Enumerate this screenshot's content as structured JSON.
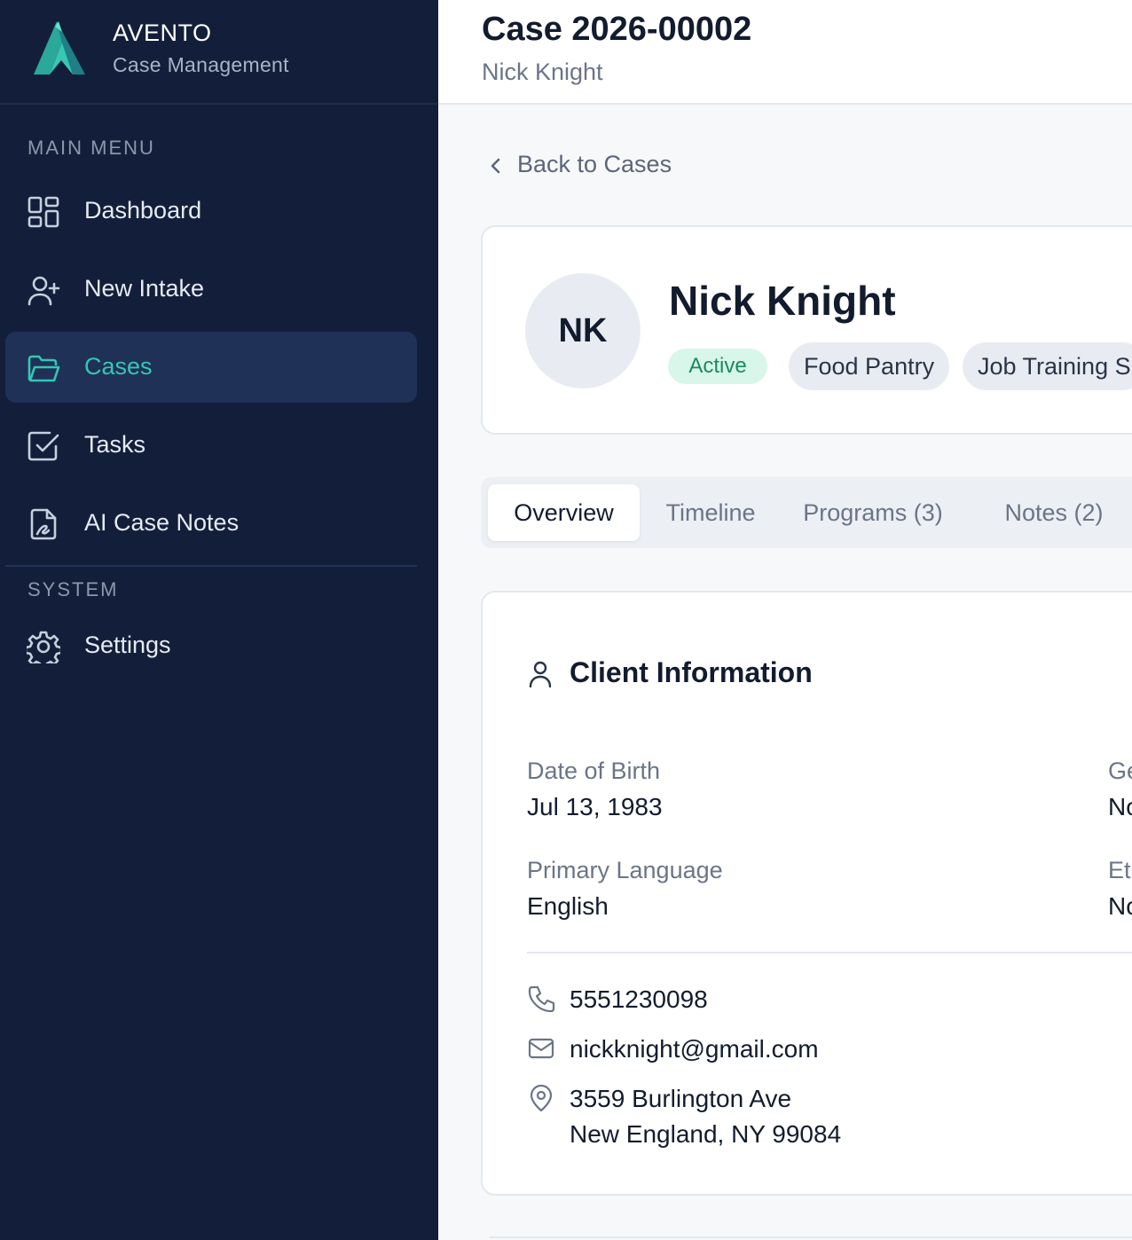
{
  "brand": {
    "name": "AVENTO",
    "subtitle": "Case Management"
  },
  "sidebar": {
    "main_title": "MAIN MENU",
    "items": [
      {
        "label": "Dashboard",
        "icon": "dashboard-grid-icon"
      },
      {
        "label": "New Intake",
        "icon": "user-plus-icon"
      },
      {
        "label": "Cases",
        "icon": "folder-open-icon",
        "active": true
      },
      {
        "label": "Tasks",
        "icon": "checkbox-icon"
      },
      {
        "label": "AI Case Notes",
        "icon": "file-signature-icon"
      }
    ],
    "system_title": "SYSTEM",
    "system_items": [
      {
        "label": "Settings",
        "icon": "gear-icon"
      }
    ]
  },
  "header": {
    "title": "Case 2026-00002",
    "subtitle": "Nick Knight"
  },
  "back_link": "Back to Cases",
  "profile": {
    "initials": "NK",
    "name": "Nick Knight",
    "status": "Active",
    "tags": [
      "Food Pantry",
      "Job Training S"
    ]
  },
  "tabs": [
    {
      "label": "Overview",
      "active": true
    },
    {
      "label": "Timeline"
    },
    {
      "label": "Programs (3)"
    },
    {
      "label": "Notes (2)"
    }
  ],
  "client_info": {
    "title": "Client Information",
    "fields": [
      {
        "label": "Date of Birth",
        "value": "Jul 13, 1983"
      },
      {
        "label": "Ge",
        "value": "No"
      },
      {
        "label": "Primary Language",
        "value": "English"
      },
      {
        "label": "Et",
        "value": "No"
      }
    ],
    "phone": "5551230098",
    "email": "nickknight@gmail.com",
    "address_line1": "3559 Burlington Ave",
    "address_line2": "New England, NY 99084"
  },
  "colors": {
    "sidebar_bg": "#131f3a",
    "accent": "#35c6b4",
    "active_badge_bg": "#d8f6e9",
    "active_badge_text": "#1a8a61"
  }
}
